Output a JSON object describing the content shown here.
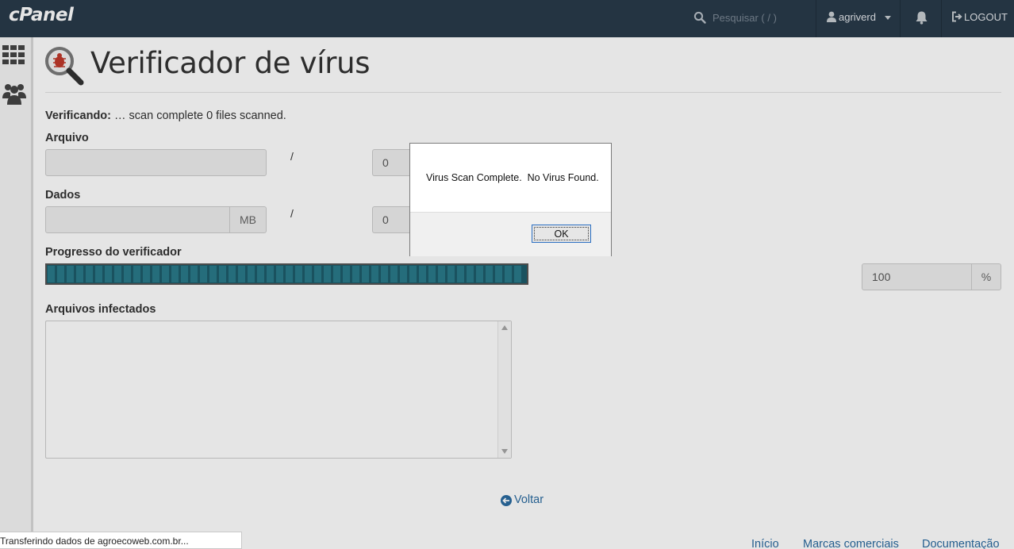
{
  "navbar": {
    "logo": "cPanel",
    "search_placeholder": "Pesquisar ( / )",
    "username": "agriverd",
    "logout_label": "LOGOUT"
  },
  "sidebar": {
    "icons": [
      "grid-icon",
      "users-icon"
    ]
  },
  "page": {
    "title": "Verificador de vírus",
    "status_label": "Verificando:",
    "status_text": " … scan complete 0 files scanned.",
    "arquivo_label": "Arquivo",
    "arquivo_current": "",
    "arquivo_total": "0",
    "dados_label": "Dados",
    "dados_current": "",
    "dados_unit": "MB",
    "dados_total": "0",
    "slash": "/",
    "progress_label": "Progresso do verificador",
    "progress_value": "100",
    "progress_unit": "%",
    "infected_label": "Arquivos infectados",
    "infected_value": "",
    "back_label": "Voltar"
  },
  "footer": {
    "links": [
      "Início",
      "Marcas comerciais",
      "Documentação"
    ]
  },
  "browser_status": "Transferindo dados de agroecoweb.com.br...",
  "dialog": {
    "message": "Virus Scan Complete.  No Virus Found.",
    "ok_label": "OK"
  },
  "colors": {
    "navbar": "#293a4a",
    "progress": "#1d5c6a",
    "link": "#2a6aa0"
  }
}
